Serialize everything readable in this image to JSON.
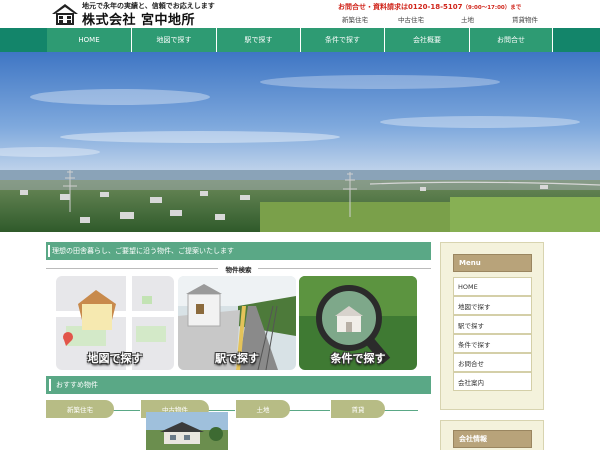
{
  "header": {
    "tagline": "地元で永年の実績と、信頼でお応えします",
    "company_name": "株式会社 宮中地所",
    "contact_label": "お問合せ・資料請求は0120-18-5107",
    "contact_hours": "（9:00～17:00）まで",
    "top_links": [
      "新築住宅",
      "中古住宅",
      "土地",
      "賃貸物件"
    ]
  },
  "nav": {
    "items": [
      "HOME",
      "地図で探す",
      "駅で探す",
      "条件で探す",
      "会社概要",
      "お問合せ"
    ]
  },
  "main": {
    "intro_text": "理想の田舎暮らし、ご要望に沿う物件、ご提案いたします",
    "search_title": "物件検索",
    "search_cards": [
      "地図で探す",
      "駅で探す",
      "条件で探す"
    ],
    "recommend_title": "おすすめ物件",
    "recommend_tabs": [
      "新築住宅",
      "中古物件",
      "土地",
      "賃貸"
    ]
  },
  "sidebar": {
    "menu_title": "Menu",
    "menu_items": [
      "HOME",
      "地図で探す",
      "駅で探す",
      "条件で探す",
      "お問合せ",
      "会社案内"
    ],
    "info_title": "会社情報"
  },
  "colors": {
    "nav_green": "#2e9b73",
    "bar_green": "#5aa886",
    "accent_red": "#d0261c",
    "tab_olive": "#b7bc85",
    "sidebar_tan": "#b8a37a"
  }
}
